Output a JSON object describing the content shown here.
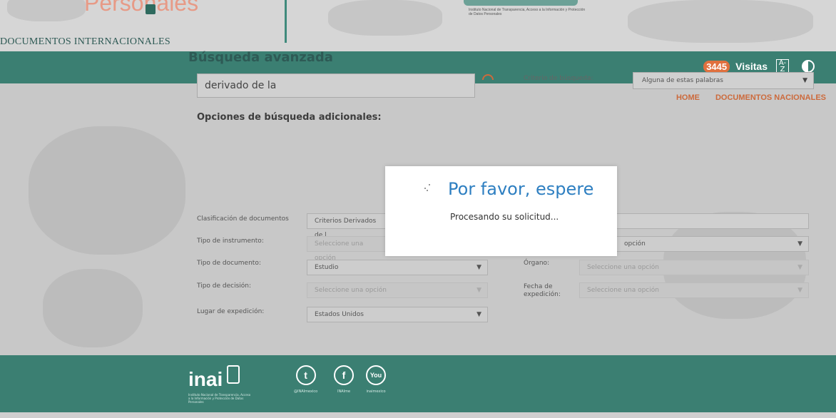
{
  "header": {
    "logo_text": "Personales",
    "section_title": "DOCUMENTOS INTERNACIONALES",
    "institute_text": "Instituto Nacional de Transparencia, Acceso a la Información y Protección de Datos Personales"
  },
  "topbar": {
    "visits_count": "3445",
    "visits_label": "Visitas",
    "az_icon": "A-Z",
    "contrast_icon": "contrast-icon"
  },
  "nav": {
    "home": "HOME",
    "docs_nacionales": "DOCUMENTOS NACIONALES"
  },
  "search": {
    "title": "Búsqueda avanzada",
    "query": "derivado de la",
    "criterio_label": "Criterio de búsqueda:",
    "criterio_value": "Alguna de estas palabras",
    "subtitle": "Opciones de búsqueda adicionales:"
  },
  "filters": {
    "clasificacion_label": "Clasificación de documentos",
    "clasificacion_value": "Criterios Derivados de l",
    "tipo_instrumento_label": "Tipo de instrumento:",
    "tipo_instrumento_value": "Seleccione una opción",
    "right_select_value": "opción",
    "tipo_documento_label": "Tipo de documento:",
    "tipo_documento_value": "Estudio",
    "organo_label": "Órgano:",
    "organo_value": "Seleccione una opción",
    "tipo_decision_label": "Tipo de decisión:",
    "tipo_decision_value": "Seleccione una opción",
    "fecha_label": "Fecha de expedición:",
    "fecha_value": "Seleccione una opción",
    "lugar_label": "Lugar de expedición:",
    "lugar_value": "Estados Unidos"
  },
  "modal": {
    "title": "Por favor, espere",
    "message": "Procesando su solicitud..."
  },
  "footer": {
    "logo": "inai",
    "tagline": "Instituto Nacional de Transparencia, Acceso a la Información y Protección de Datos Personales",
    "twitter_label": "@INAImexico",
    "facebook_label": "INAIme",
    "youtube_label": "inaimexico",
    "twitter_icon": "twitter-icon",
    "facebook_icon": "facebook-icon",
    "youtube_icon": "youtube-icon"
  }
}
